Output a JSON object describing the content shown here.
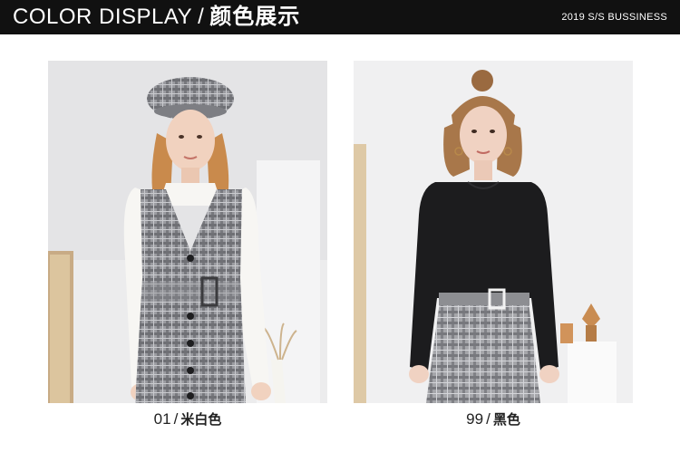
{
  "header": {
    "title_en": "COLOR DISPLAY",
    "separator": "/",
    "title_zh": "颜色展示",
    "season": "2019 S/S BUSSINESS"
  },
  "products": [
    {
      "code": "01",
      "separator": "/",
      "color_name": "米白色",
      "photo_desc": "model-in-plaid-beret-and-pinafore-dress",
      "colors": {
        "background": "#ececed",
        "top": "#f7f6f3",
        "plaid": "#8e8f93"
      }
    },
    {
      "code": "99",
      "separator": "/",
      "color_name": "黑色",
      "photo_desc": "model-in-black-sweater-and-plaid-trousers",
      "colors": {
        "background": "#f0f0f1",
        "top": "#1c1c1e",
        "plaid": "#9a9b9f"
      }
    }
  ]
}
